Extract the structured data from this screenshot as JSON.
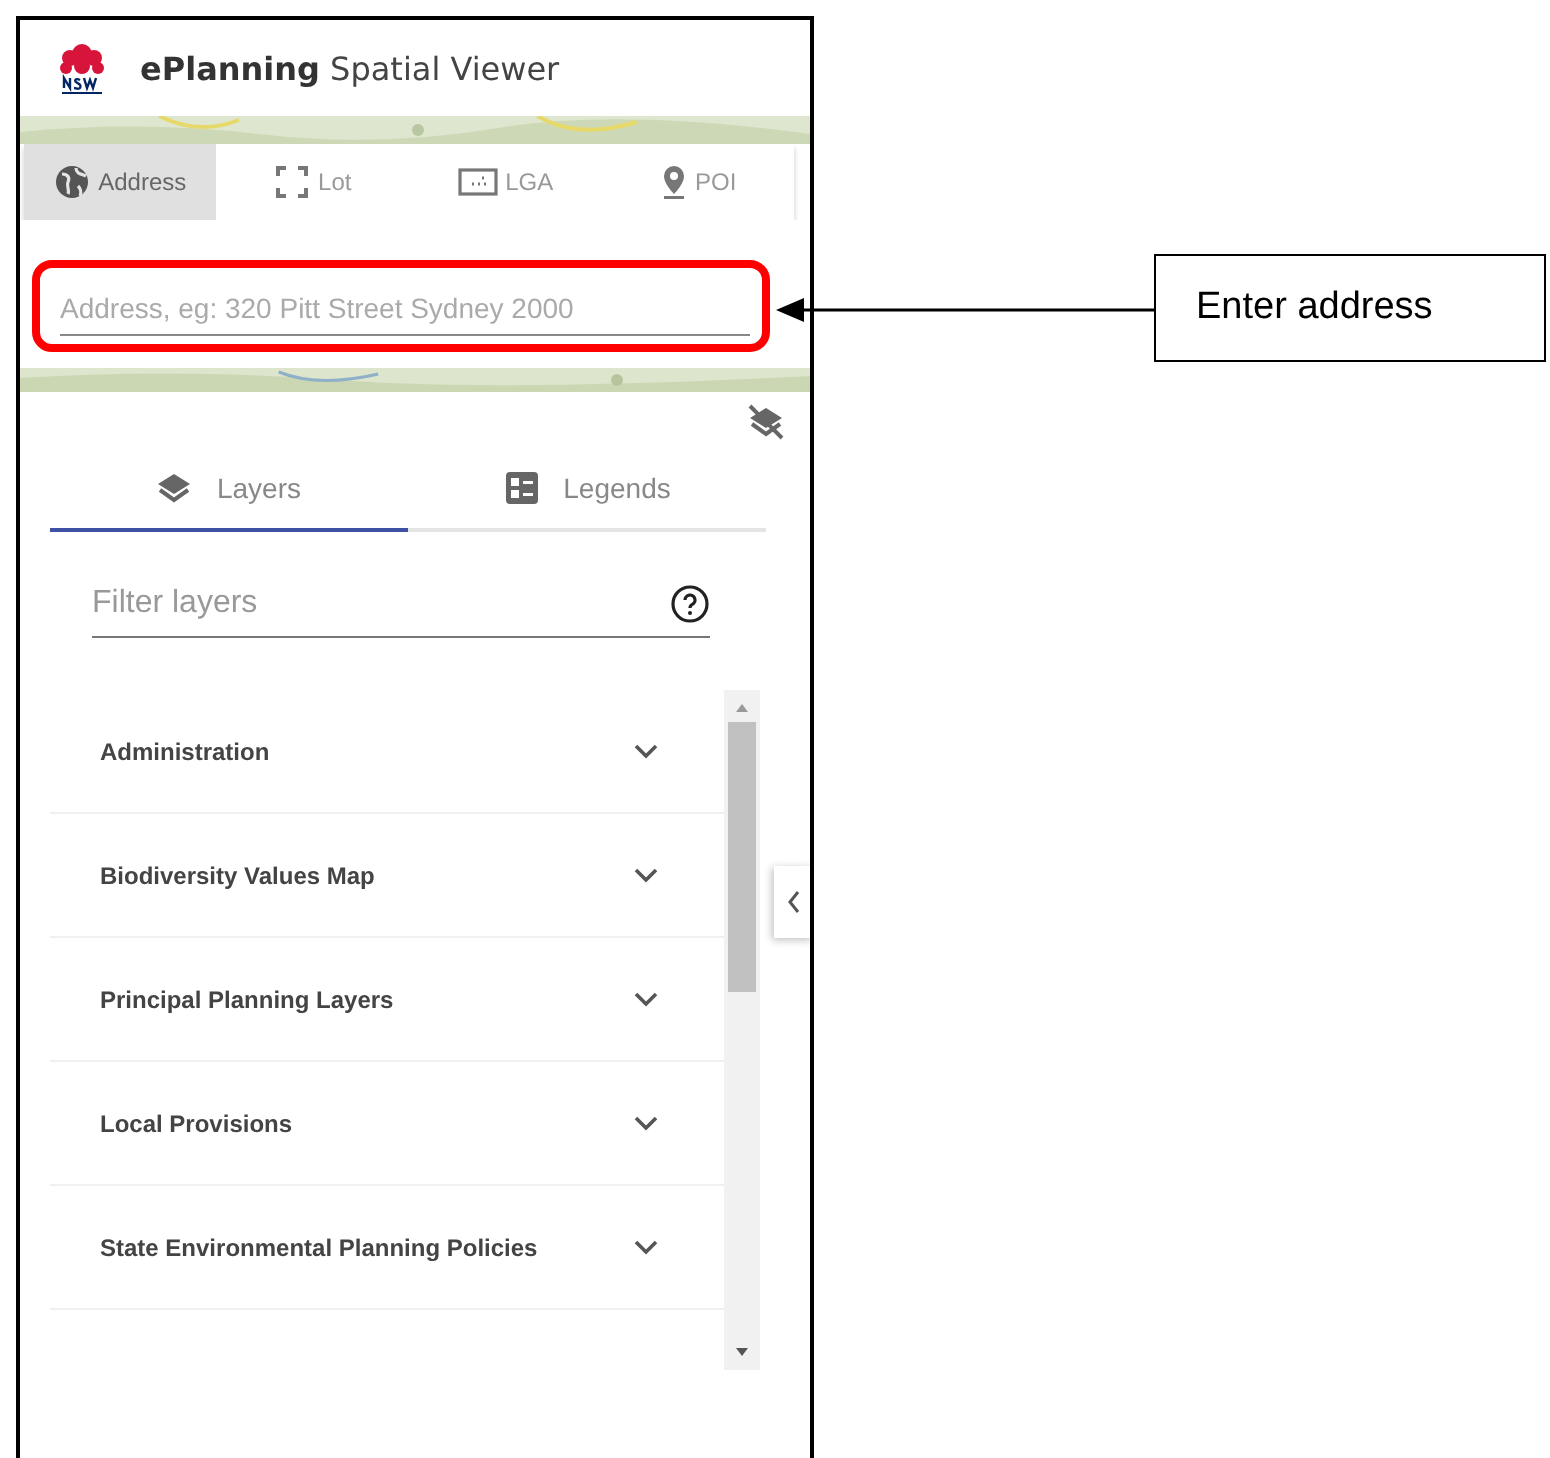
{
  "header": {
    "title": "**ePlanning** Spatial Viewer"
  },
  "search_tabs": [
    {
      "label": "Address",
      "selected": true
    },
    {
      "label": "Lot",
      "selected": false
    },
    {
      "label": "LGA",
      "selected": false
    },
    {
      "label": "POI",
      "selected": false
    }
  ],
  "address_field": {
    "placeholder": "Address, eg: 320 Pitt Street Sydney 2000"
  },
  "panel_tabs": [
    {
      "label": "Layers",
      "selected": true
    },
    {
      "label": "Legends",
      "selected": false
    }
  ],
  "filter_field": {
    "placeholder": "Filter layers"
  },
  "layer_groups": [
    {
      "name": "Administration",
      "expanded": false
    },
    {
      "name": "Biodiversity Values Map",
      "expanded": false
    },
    {
      "name": "Principal Planning Layers",
      "expanded": false
    },
    {
      "name": "Local Provisions",
      "expanded": false
    },
    {
      "name": "State Environmental Planning Policies",
      "expanded": false
    }
  ],
  "callout": {
    "text": "Enter address"
  }
}
